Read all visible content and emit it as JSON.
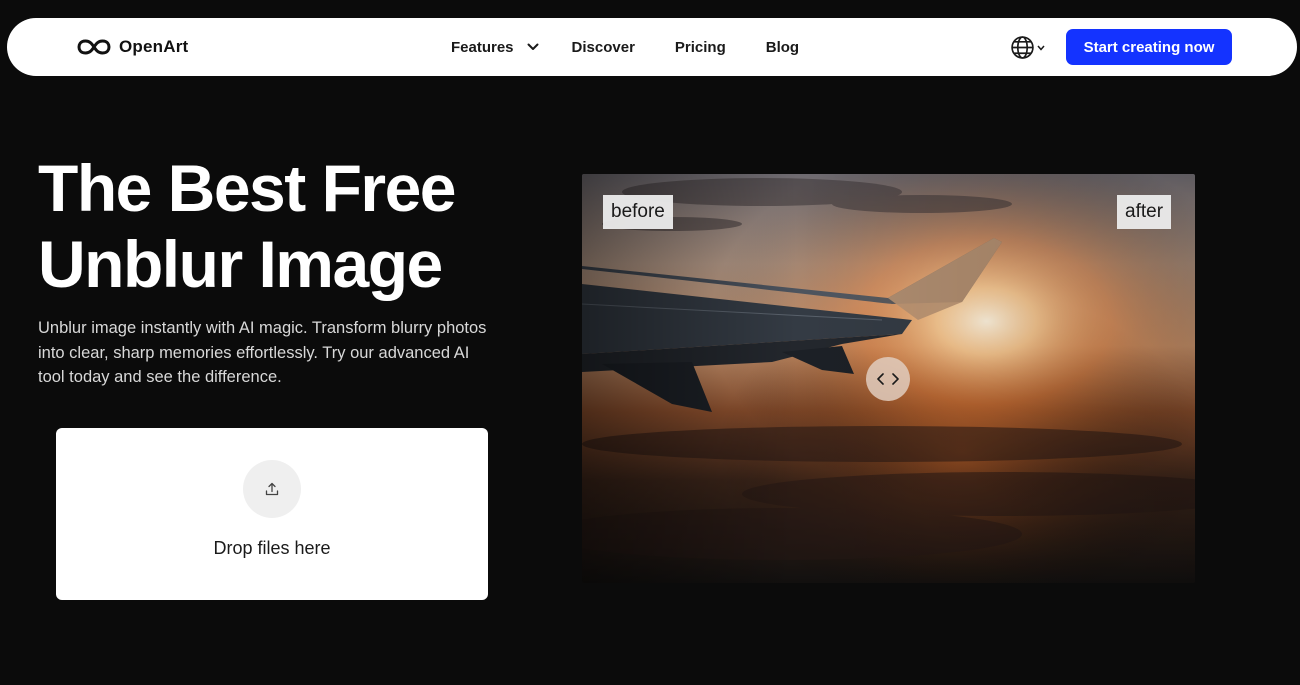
{
  "nav": {
    "brand": "OpenArt",
    "links": [
      {
        "label": "Features",
        "has_dropdown": true
      },
      {
        "label": "Discover"
      },
      {
        "label": "Pricing"
      },
      {
        "label": "Blog"
      }
    ],
    "language_icon": "globe-icon",
    "cta_label": "Start creating now",
    "cta_color": "#1433ff"
  },
  "hero": {
    "title_line1": "The Best Free",
    "title_line2": "Unblur Image",
    "description": "Unblur image instantly with AI magic. Transform blurry photos into clear, sharp memories effortlessly. Try our advanced AI tool today and see the difference."
  },
  "upload": {
    "icon": "upload-icon",
    "label": "Drop files here"
  },
  "compare": {
    "before_label": "before",
    "after_label": "after",
    "handle_icon": "code-arrows-icon",
    "slider_position": 0.5
  },
  "colors": {
    "background": "#0b0b0b",
    "accent": "#1433ff",
    "nav_bg": "#ffffff"
  }
}
